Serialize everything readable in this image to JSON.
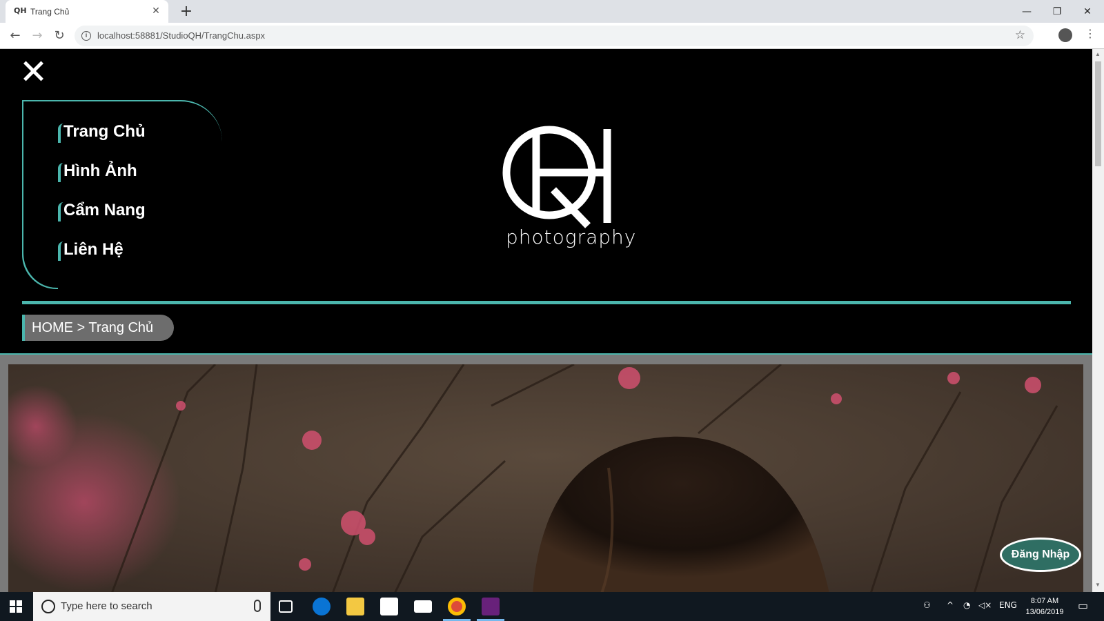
{
  "browser": {
    "tab_title": "Trang Chủ",
    "tab_favicon": "QH",
    "url": "localhost:58881/StudioQH/TrangChu.aspx"
  },
  "page": {
    "menu": [
      {
        "label": "Trang Chủ"
      },
      {
        "label": "Hình Ảnh"
      },
      {
        "label": "Cẩm Nang"
      },
      {
        "label": "Liên Hệ"
      }
    ],
    "logo_text": "photography",
    "breadcrumb": "HOME > Trang Chủ",
    "login_button": "Đăng Nhập"
  },
  "taskbar": {
    "search_placeholder": "Type here to search",
    "language": "ENG",
    "time": "8:07 AM",
    "date": "13/06/2019"
  },
  "colors": {
    "accent": "#4bb6ad",
    "login_bg": "#2f6e63",
    "page_bg": "#000000"
  }
}
